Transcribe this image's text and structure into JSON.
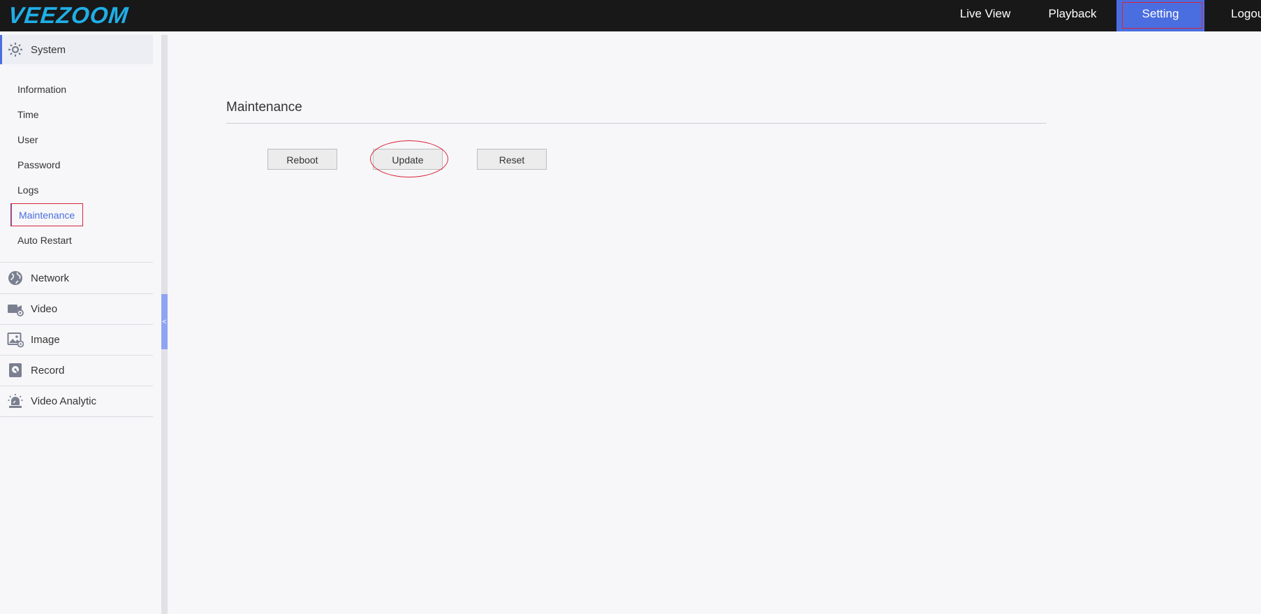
{
  "header": {
    "logo": "VEEZOOM",
    "nav": [
      {
        "label": "Live View"
      },
      {
        "label": "Playback"
      },
      {
        "label": "Setting",
        "active": true
      },
      {
        "label": "Logout"
      }
    ]
  },
  "sidebar": {
    "sections": [
      {
        "label": "System",
        "icon": "gear-icon",
        "active": true
      },
      {
        "label": "Network",
        "icon": "globe-icon"
      },
      {
        "label": "Video",
        "icon": "video-camera-icon"
      },
      {
        "label": "Image",
        "icon": "image-icon"
      },
      {
        "label": "Record",
        "icon": "record-disk-icon"
      },
      {
        "label": "Video Analytic",
        "icon": "alarm-light-icon"
      }
    ],
    "system_items": [
      {
        "label": "Information"
      },
      {
        "label": "Time"
      },
      {
        "label": "User"
      },
      {
        "label": "Password"
      },
      {
        "label": "Logs"
      },
      {
        "label": "Maintenance",
        "active": true
      },
      {
        "label": "Auto Restart"
      }
    ],
    "collapse_glyph": "<"
  },
  "main": {
    "title": "Maintenance",
    "buttons": {
      "reboot": "Reboot",
      "update": "Update",
      "reset": "Reset"
    }
  },
  "colors": {
    "topbar": "#181818",
    "accent": "#4a6ee0",
    "annotation_red": "#d9243a",
    "logo": "#20aee6"
  }
}
